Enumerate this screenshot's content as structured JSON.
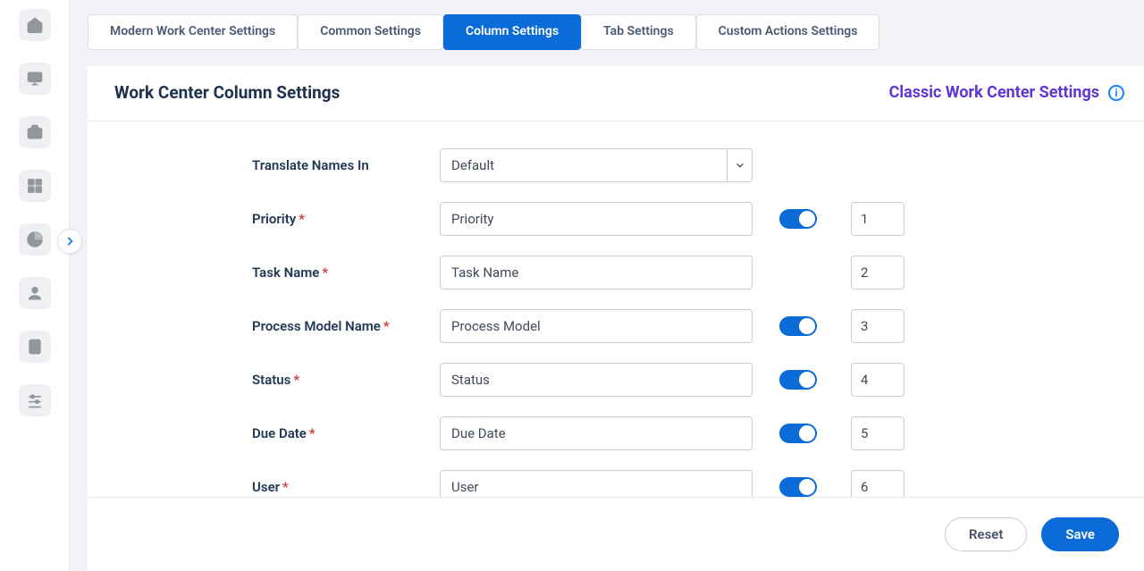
{
  "tabs": {
    "items": [
      {
        "label": "Modern Work Center Settings",
        "active": false
      },
      {
        "label": "Common Settings",
        "active": false
      },
      {
        "label": "Column Settings",
        "active": true
      },
      {
        "label": "Tab Settings",
        "active": false
      },
      {
        "label": "Custom Actions Settings",
        "active": false
      }
    ]
  },
  "header": {
    "title": "Work Center Column Settings",
    "classic_link": "Classic Work Center Settings",
    "info_mark": "i"
  },
  "translate_row": {
    "label": "Translate Names In",
    "value": "Default"
  },
  "columns": [
    {
      "label": "Priority",
      "required": true,
      "value": "Priority",
      "toggle": true,
      "has_toggle": true,
      "order": "1"
    },
    {
      "label": "Task Name",
      "required": true,
      "value": "Task Name",
      "toggle": true,
      "has_toggle": false,
      "order": "2"
    },
    {
      "label": "Process Model Name",
      "required": true,
      "value": "Process Model",
      "toggle": true,
      "has_toggle": true,
      "order": "3"
    },
    {
      "label": "Status",
      "required": true,
      "value": "Status",
      "toggle": true,
      "has_toggle": true,
      "order": "4"
    },
    {
      "label": "Due Date",
      "required": true,
      "value": "Due Date",
      "toggle": true,
      "has_toggle": true,
      "order": "5"
    },
    {
      "label": "User",
      "required": true,
      "value": "User",
      "toggle": true,
      "has_toggle": true,
      "order": "6"
    }
  ],
  "footer": {
    "reset": "Reset",
    "save": "Save"
  },
  "sidebar": {
    "icons": [
      "home-icon",
      "monitor-icon",
      "briefcase-icon",
      "squares-icon",
      "piechart-icon",
      "user-icon",
      "calculator-icon",
      "sliders-icon"
    ]
  }
}
